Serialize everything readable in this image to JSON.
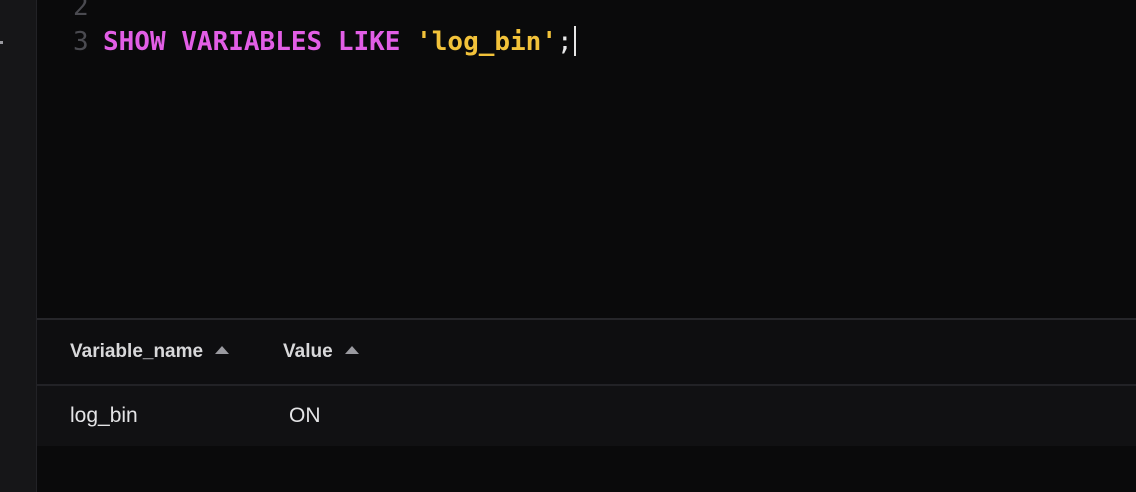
{
  "editor": {
    "lines": [
      {
        "number": "2",
        "tokens": []
      },
      {
        "number": "3",
        "tokens": [
          {
            "type": "keyword",
            "text": "SHOW"
          },
          {
            "type": "space",
            "text": " "
          },
          {
            "type": "keyword",
            "text": "VARIABLES"
          },
          {
            "type": "space",
            "text": " "
          },
          {
            "type": "keyword",
            "text": "LIKE"
          },
          {
            "type": "space",
            "text": " "
          },
          {
            "type": "string",
            "text": "'log_bin'"
          },
          {
            "type": "punct",
            "text": ";"
          }
        ]
      }
    ]
  },
  "results": {
    "columns": [
      {
        "label": "Variable_name",
        "sort": "ascending",
        "sort_icon": "sort-asc-icon"
      },
      {
        "label": "Value",
        "sort": "ascending",
        "sort_icon": "sort-asc-icon"
      }
    ],
    "rows": [
      [
        "log_bin",
        "ON"
      ]
    ]
  },
  "colors": {
    "keyword": "#e25ee6",
    "string": "#f2c23a",
    "background": "#0a0a0b"
  }
}
